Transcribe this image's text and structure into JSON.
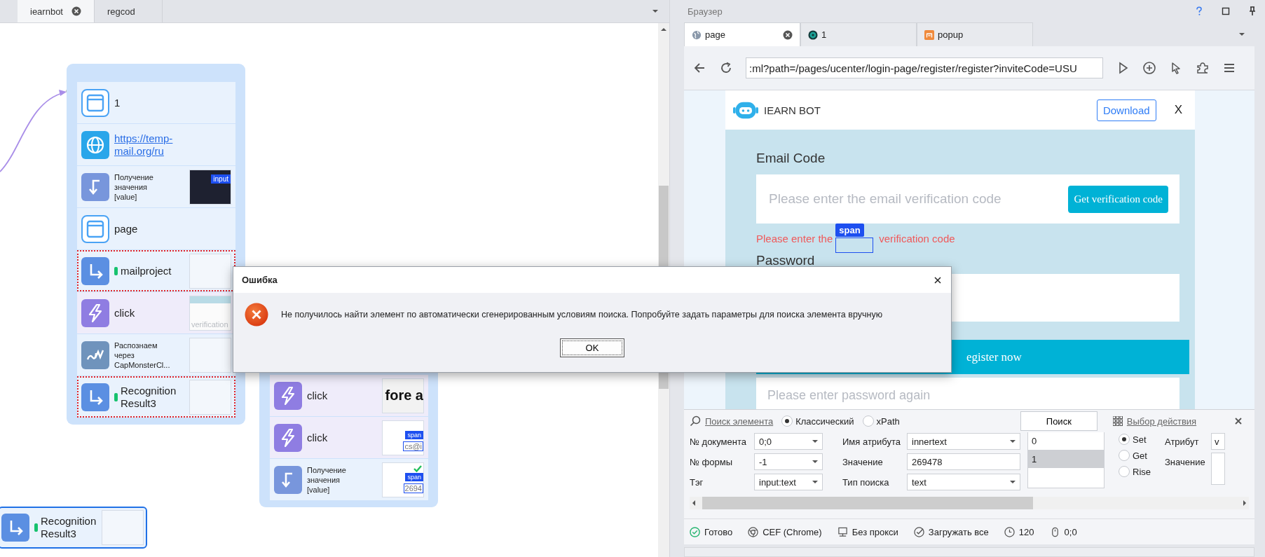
{
  "editor": {
    "tabs": [
      {
        "label": "iearnbot",
        "selected": true,
        "closable": true
      },
      {
        "label": "regcod",
        "selected": false,
        "closable": false
      }
    ]
  },
  "canvas": {
    "groups": [
      {
        "nodes": [
          {
            "kind": "window",
            "label": "1",
            "flagged": false
          },
          {
            "kind": "navigate",
            "label": "https://temp-mail.org/ru",
            "flagged": false
          },
          {
            "kind": "get_value",
            "label": "Получение значения [value]",
            "flagged": false,
            "thumb": {
              "kind": "dark",
              "tag": "input"
            }
          },
          {
            "kind": "window",
            "label": "page",
            "flagged": false
          },
          {
            "kind": "variable",
            "label": "mailproject",
            "flagged": true,
            "thumb": {
              "kind": "blank"
            }
          },
          {
            "kind": "click",
            "label": "click",
            "flagged": false,
            "thumb": {
              "kind": "caption",
              "text": "verification"
            }
          },
          {
            "kind": "captcha",
            "label": "Распознаем через CapMonsterCl...",
            "flagged": false,
            "thumb": {
              "kind": "blank"
            }
          },
          {
            "kind": "variable",
            "label": "RecognitionResult3",
            "flagged": true,
            "thumb": {
              "kind": "blank"
            }
          }
        ]
      },
      {
        "nodes": [
          {
            "kind": "click",
            "label": "click",
            "flagged": false,
            "thumb": {
              "kind": "big",
              "text": "fore a"
            }
          },
          {
            "kind": "click",
            "label": "click",
            "flagged": false,
            "thumb": {
              "kind": "tag",
              "tag": "span",
              "text": "cs@i",
              "checked": false
            }
          },
          {
            "kind": "get_value",
            "label": "Получение значения [value]",
            "flagged": false,
            "thumb": {
              "kind": "tag",
              "tag": "span",
              "text": "2694",
              "checked": true
            }
          }
        ]
      }
    ],
    "loose_nodes": [
      {
        "kind": "variable",
        "label": "RecognitionResult3",
        "selected": true,
        "thumb": {
          "kind": "blank"
        }
      }
    ]
  },
  "browser": {
    "title": "Браузер",
    "tabs": [
      {
        "label": "page",
        "selected": true,
        "closable": true
      },
      {
        "label": "1",
        "selected": false,
        "closable": false
      },
      {
        "label": "popup",
        "selected": false,
        "closable": false
      }
    ],
    "address": ":ml?path=/pages/ucenter/login-page/register/register?inviteCode=USU",
    "page": {
      "brand": "IEARN BOT",
      "download": "Download",
      "close": "X",
      "email_label": "Email Code",
      "email_placeholder": "Please enter the email verification code",
      "code_button": "Get verification code",
      "error_start": "Please enter the",
      "error_end": "verification code",
      "highlight_tag": "span",
      "password_label": "Password",
      "register_button": "egister now",
      "confirm_placeholder": "Please enter password again"
    }
  },
  "search_panel": {
    "title": "Поиск элемента",
    "modes": [
      {
        "label": "Классический",
        "selected": true
      },
      {
        "label": "xPath",
        "selected": false
      }
    ],
    "search_button": "Поиск",
    "action_link": "Выбор действия",
    "fields": [
      {
        "label": "№ документа",
        "kind": "dropdown",
        "value": "0;0"
      },
      {
        "label": "№ формы",
        "kind": "dropdown",
        "value": "-1"
      },
      {
        "label": "Тэг",
        "kind": "dropdown",
        "value": "input:text"
      },
      {
        "label": "Имя атрибута",
        "kind": "dropdown",
        "value": "innertext"
      },
      {
        "label": "Значение",
        "kind": "input",
        "value": "269478"
      },
      {
        "label": "Тип поиска",
        "kind": "dropdown",
        "value": "text"
      }
    ],
    "results": [
      {
        "label": "0",
        "selected": false
      },
      {
        "label": "1",
        "selected": true
      }
    ],
    "actions": [
      {
        "label": "Set",
        "selected": true
      },
      {
        "label": "Get",
        "selected": false
      },
      {
        "label": "Rise",
        "selected": false
      }
    ],
    "attribute": {
      "label": "Атрибут",
      "value": "v"
    },
    "value_label": "Значение"
  },
  "status_bar": [
    {
      "kind": "ready",
      "text": "Готово"
    },
    {
      "kind": "engine",
      "text": "CEF (Chrome)"
    },
    {
      "kind": "proxy",
      "text": "Без прокси"
    },
    {
      "kind": "load",
      "text": "Загружать все"
    },
    {
      "kind": "timeout",
      "text": "120"
    },
    {
      "kind": "mouse",
      "text": "0;0"
    }
  ],
  "dialog": {
    "title": "Ошибка",
    "message": "Не получилось найти элемент по автоматически сгенерированным условиям поиска. Попробуйте задать параметры для поиска элемента вручную",
    "button": "OK"
  }
}
